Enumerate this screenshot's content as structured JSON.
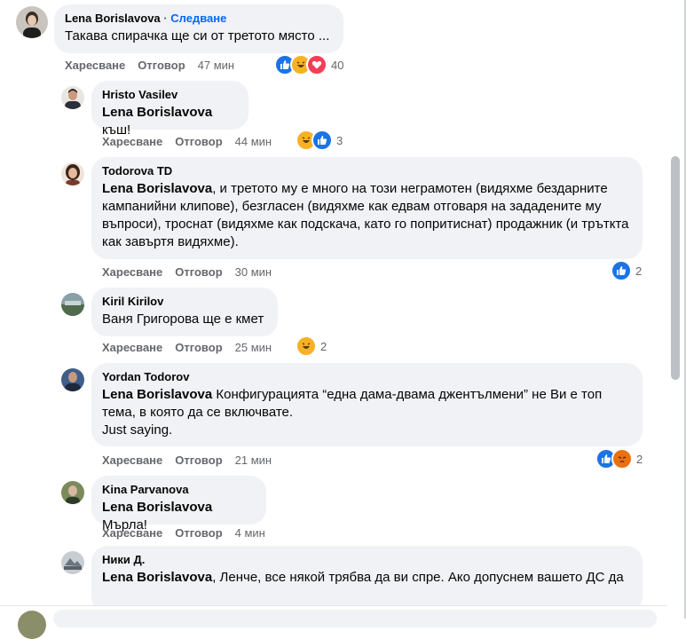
{
  "labels": {
    "like": "Харесване",
    "reply": "Отговор",
    "follow": "Следване",
    "dot": "·"
  },
  "comments": [
    {
      "author": "Lena Borislavova",
      "text": "Такава спирачка ще си от третото място ...",
      "time": "47 мин",
      "reactions": [
        "like",
        "haha",
        "love"
      ],
      "count": "40"
    },
    {
      "author": "Hristo Vasilev",
      "mention": "Lena Borislavova",
      "text": " къш!",
      "time": "44 мин",
      "reactions": [
        "haha",
        "like"
      ],
      "count": "3"
    },
    {
      "author": "Todorova TD",
      "mention": "Lena Borislavova",
      "text": ", и третото му е много на този неграмотен (видяхме бездарните кампанийни клипове), безгласен (видяхме как едвам отговаря на зададените му въпроси), троснат (видяхме как подскача, като го попритиснат) продажник (и тръткта как завъртя видяхме).",
      "time": "30 мин",
      "reactions": [
        "like"
      ],
      "count": "2"
    },
    {
      "author": "Kiril Kirilov",
      "text": "Ваня Григорова ще е кмет",
      "time": "25 мин",
      "reactions": [
        "haha"
      ],
      "count": "2"
    },
    {
      "author": "Yordan Todorov",
      "mention": "Lena Borislavova",
      "text": " Конфигурацията “една дама-двама джентълмени” не Ви е топ тема, в която да се включвате.",
      "text2": "Just saying.",
      "time": "21 мин",
      "reactions": [
        "like",
        "angry"
      ],
      "count": "2"
    },
    {
      "author": "Kina Parvanova",
      "mention": "Lena Borislavova",
      "text": " Мърла!",
      "time": "4 мин",
      "reactions": [],
      "count": ""
    },
    {
      "author": "Ники Д.",
      "mention": "Lena Borislavova",
      "text": ", Ленче, все някой трябва да ви спре. Ако допуснем вашето ДС да"
    }
  ]
}
